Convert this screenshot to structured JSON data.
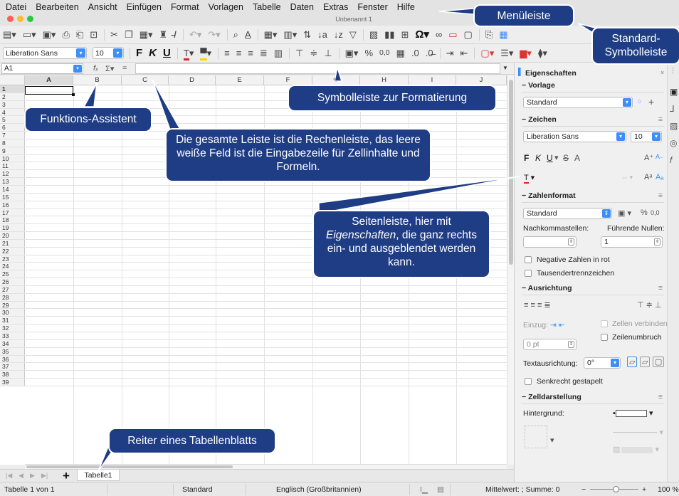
{
  "menu": [
    "Datei",
    "Bearbeiten",
    "Ansicht",
    "Einfügen",
    "Format",
    "Vorlagen",
    "Tabelle",
    "Daten",
    "Extras",
    "Fenster",
    "Hilfe"
  ],
  "window_title": "Unbenannt 1",
  "traffic_colors": [
    "#fc5f57",
    "#fdbc2e",
    "#28c840"
  ],
  "toolbar_format": {
    "font_name": "Liberation Sans",
    "font_size": "10",
    "bold": "F",
    "italic": "K",
    "underline": "U",
    "percent": "%",
    "decimal": "0,0"
  },
  "formula_bar": {
    "name_box": "A1",
    "fx": "f",
    "sigma": "Σ",
    "equals": "="
  },
  "columns": [
    "A",
    "B",
    "C",
    "D",
    "E",
    "F",
    "G",
    "H",
    "I",
    "J"
  ],
  "rows": [
    "1",
    "2",
    "3",
    "4",
    "5",
    "6",
    "7",
    "8",
    "9",
    "10",
    "11",
    "12",
    "13",
    "14",
    "15",
    "16",
    "17",
    "18",
    "19",
    "20",
    "21",
    "22",
    "23",
    "24",
    "25",
    "26",
    "27",
    "28",
    "29",
    "30",
    "31",
    "32",
    "33",
    "34",
    "35",
    "36",
    "37",
    "38",
    "39"
  ],
  "sheet_tab": "Tabelle1",
  "status": {
    "sheet": "Tabelle 1 von 1",
    "style": "Standard",
    "language": "Englisch (Großbritannien)",
    "summary": "Mittelwert: ; Summe: 0",
    "zoom": "100 %"
  },
  "sidebar": {
    "title": "Eigenschaften",
    "vorlage_header": "Vorlage",
    "vorlage_value": "Standard",
    "zeichen_header": "Zeichen",
    "font_name": "Liberation Sans",
    "font_size": "10",
    "bold": "F",
    "italic": "K",
    "underline": "U",
    "strike": "S",
    "shadow": "A",
    "grow": "A",
    "shrink": "A",
    "zahlenformat_header": "Zahlenformat",
    "number_format": "Standard",
    "percent": "%",
    "decimal": "0,0",
    "decimals_label": "Nachkommastellen:",
    "leading_zeros_label": "Führende Nullen:",
    "leading_zeros_value": "1",
    "negative_red": "Negative Zahlen in rot",
    "thousands_sep": "Tausendertrennzeichen",
    "ausrichtung_header": "Ausrichtung",
    "merge_cells": "Zellen verbinden",
    "wrap_text": "Zeilenumbruch",
    "indent_label": "Einzug:",
    "indent_value": "0 pt",
    "text_orientation_label": "Textausrichtung:",
    "text_orientation_value": "0°",
    "stacked_vertical": "Senkrecht gestapelt",
    "zelldarstellung_header": "Zelldarstellung",
    "background_label": "Hintergrund:"
  },
  "callouts": {
    "menubar": "Menüleiste",
    "standard_toolbar": "Standard-\nSymbolleiste",
    "format_toolbar": "Symbolleiste zur Formatierung",
    "function_wizard": "Funktions-Assistent",
    "formula_bar": "Die gesamte Leiste ist die Rechenleiste, das leere weiße Feld ist die Eingabezeile für Zellinhalte und Formeln.",
    "sidebar_pre": "Seitenleiste, hier mit ",
    "sidebar_em": "Eigenschaften",
    "sidebar_post": ", die ganz rechts ein- und ausgeblendet werden kann.",
    "sheet_tab": "Reiter eines Tabellenblatts"
  },
  "colors": {
    "callout_bg": "#1f3d84",
    "accent": "#3d8ef7",
    "font_color_red": "#e02020",
    "highlight_yellow": "#f5d800"
  }
}
